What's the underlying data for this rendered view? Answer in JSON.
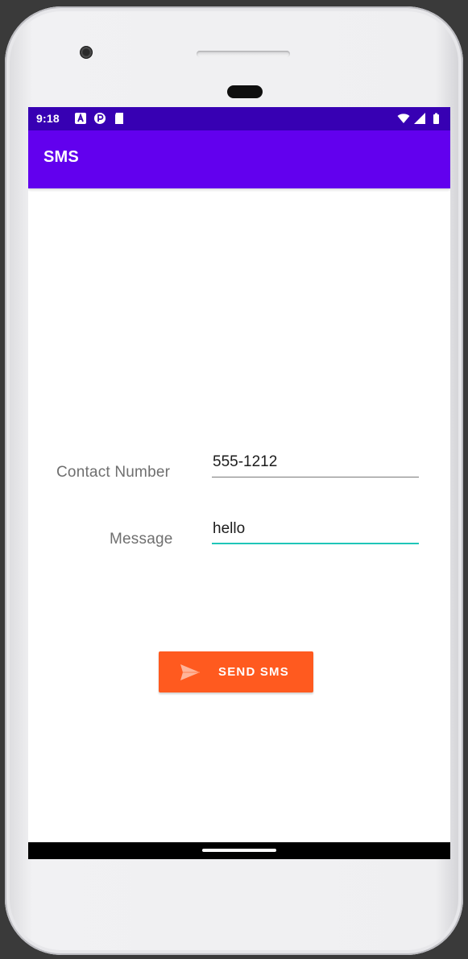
{
  "status_bar": {
    "time": "9:18",
    "left_icons": [
      "a-notification-icon",
      "p-notification-icon",
      "sd-card-icon"
    ],
    "right_icons": [
      "wifi-icon",
      "cell-signal-icon",
      "battery-icon"
    ],
    "bg_color": "#3700b3"
  },
  "app_bar": {
    "title": "SMS",
    "bg_color": "#6200ee"
  },
  "form": {
    "contact_label": "Contact Number",
    "contact_value": "555-1212",
    "message_label": "Message",
    "message_value": "hello",
    "focus_color": "#1fc6b8"
  },
  "actions": {
    "send_label": "SEND SMS",
    "send_icon": "send-icon",
    "button_color": "#ff5a1f"
  }
}
